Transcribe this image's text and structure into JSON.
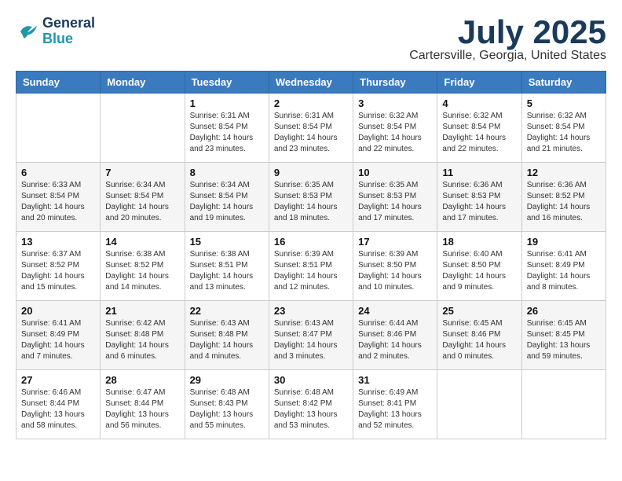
{
  "logo": {
    "line1": "General",
    "line2": "Blue"
  },
  "title": "July 2025",
  "location": "Cartersville, Georgia, United States",
  "weekdays": [
    "Sunday",
    "Monday",
    "Tuesday",
    "Wednesday",
    "Thursday",
    "Friday",
    "Saturday"
  ],
  "weeks": [
    [
      {
        "day": "",
        "info": ""
      },
      {
        "day": "",
        "info": ""
      },
      {
        "day": "1",
        "info": "Sunrise: 6:31 AM\nSunset: 8:54 PM\nDaylight: 14 hours and 23 minutes."
      },
      {
        "day": "2",
        "info": "Sunrise: 6:31 AM\nSunset: 8:54 PM\nDaylight: 14 hours and 23 minutes."
      },
      {
        "day": "3",
        "info": "Sunrise: 6:32 AM\nSunset: 8:54 PM\nDaylight: 14 hours and 22 minutes."
      },
      {
        "day": "4",
        "info": "Sunrise: 6:32 AM\nSunset: 8:54 PM\nDaylight: 14 hours and 22 minutes."
      },
      {
        "day": "5",
        "info": "Sunrise: 6:32 AM\nSunset: 8:54 PM\nDaylight: 14 hours and 21 minutes."
      }
    ],
    [
      {
        "day": "6",
        "info": "Sunrise: 6:33 AM\nSunset: 8:54 PM\nDaylight: 14 hours and 20 minutes."
      },
      {
        "day": "7",
        "info": "Sunrise: 6:34 AM\nSunset: 8:54 PM\nDaylight: 14 hours and 20 minutes."
      },
      {
        "day": "8",
        "info": "Sunrise: 6:34 AM\nSunset: 8:54 PM\nDaylight: 14 hours and 19 minutes."
      },
      {
        "day": "9",
        "info": "Sunrise: 6:35 AM\nSunset: 8:53 PM\nDaylight: 14 hours and 18 minutes."
      },
      {
        "day": "10",
        "info": "Sunrise: 6:35 AM\nSunset: 8:53 PM\nDaylight: 14 hours and 17 minutes."
      },
      {
        "day": "11",
        "info": "Sunrise: 6:36 AM\nSunset: 8:53 PM\nDaylight: 14 hours and 17 minutes."
      },
      {
        "day": "12",
        "info": "Sunrise: 6:36 AM\nSunset: 8:52 PM\nDaylight: 14 hours and 16 minutes."
      }
    ],
    [
      {
        "day": "13",
        "info": "Sunrise: 6:37 AM\nSunset: 8:52 PM\nDaylight: 14 hours and 15 minutes."
      },
      {
        "day": "14",
        "info": "Sunrise: 6:38 AM\nSunset: 8:52 PM\nDaylight: 14 hours and 14 minutes."
      },
      {
        "day": "15",
        "info": "Sunrise: 6:38 AM\nSunset: 8:51 PM\nDaylight: 14 hours and 13 minutes."
      },
      {
        "day": "16",
        "info": "Sunrise: 6:39 AM\nSunset: 8:51 PM\nDaylight: 14 hours and 12 minutes."
      },
      {
        "day": "17",
        "info": "Sunrise: 6:39 AM\nSunset: 8:50 PM\nDaylight: 14 hours and 10 minutes."
      },
      {
        "day": "18",
        "info": "Sunrise: 6:40 AM\nSunset: 8:50 PM\nDaylight: 14 hours and 9 minutes."
      },
      {
        "day": "19",
        "info": "Sunrise: 6:41 AM\nSunset: 8:49 PM\nDaylight: 14 hours and 8 minutes."
      }
    ],
    [
      {
        "day": "20",
        "info": "Sunrise: 6:41 AM\nSunset: 8:49 PM\nDaylight: 14 hours and 7 minutes."
      },
      {
        "day": "21",
        "info": "Sunrise: 6:42 AM\nSunset: 8:48 PM\nDaylight: 14 hours and 6 minutes."
      },
      {
        "day": "22",
        "info": "Sunrise: 6:43 AM\nSunset: 8:48 PM\nDaylight: 14 hours and 4 minutes."
      },
      {
        "day": "23",
        "info": "Sunrise: 6:43 AM\nSunset: 8:47 PM\nDaylight: 14 hours and 3 minutes."
      },
      {
        "day": "24",
        "info": "Sunrise: 6:44 AM\nSunset: 8:46 PM\nDaylight: 14 hours and 2 minutes."
      },
      {
        "day": "25",
        "info": "Sunrise: 6:45 AM\nSunset: 8:46 PM\nDaylight: 14 hours and 0 minutes."
      },
      {
        "day": "26",
        "info": "Sunrise: 6:45 AM\nSunset: 8:45 PM\nDaylight: 13 hours and 59 minutes."
      }
    ],
    [
      {
        "day": "27",
        "info": "Sunrise: 6:46 AM\nSunset: 8:44 PM\nDaylight: 13 hours and 58 minutes."
      },
      {
        "day": "28",
        "info": "Sunrise: 6:47 AM\nSunset: 8:44 PM\nDaylight: 13 hours and 56 minutes."
      },
      {
        "day": "29",
        "info": "Sunrise: 6:48 AM\nSunset: 8:43 PM\nDaylight: 13 hours and 55 minutes."
      },
      {
        "day": "30",
        "info": "Sunrise: 6:48 AM\nSunset: 8:42 PM\nDaylight: 13 hours and 53 minutes."
      },
      {
        "day": "31",
        "info": "Sunrise: 6:49 AM\nSunset: 8:41 PM\nDaylight: 13 hours and 52 minutes."
      },
      {
        "day": "",
        "info": ""
      },
      {
        "day": "",
        "info": ""
      }
    ]
  ]
}
